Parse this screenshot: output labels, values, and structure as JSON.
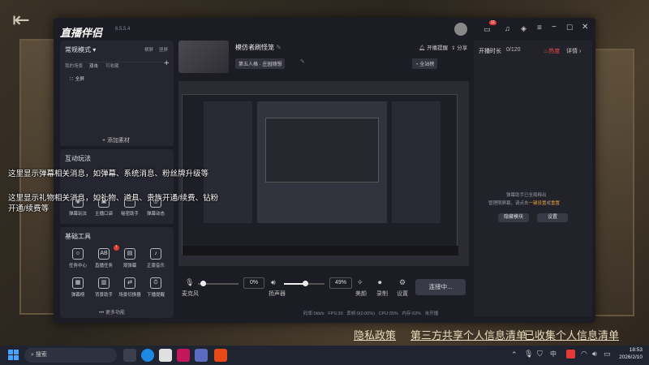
{
  "app": {
    "name": "直播伴侣",
    "version": "6.5.5.4"
  },
  "stream": {
    "title": "模仿者刷怪笼",
    "category": "第五人格 · 庄园随想",
    "fans_label": "全站榜"
  },
  "header": {
    "announce": "开播提醒",
    "share": "分享"
  },
  "left": {
    "mode": "常规模式",
    "mode_opts": [
      "横屏",
      "竖屏"
    ],
    "scene_tabs": [
      "我的场景",
      "双击",
      "可收藏"
    ],
    "source_item": "全屏",
    "add_source": "+ 添加素材",
    "interact_title": "互动玩法",
    "interact_items": [
      "弹幕玩法",
      "主播口袋",
      "秘密助手",
      "弹幕动态"
    ],
    "basic_title": "基础工具",
    "tools_row1": [
      "任务中心",
      "直播任务",
      "观弹幕",
      "正版音乐"
    ],
    "tools_row2": [
      "弹幕榜",
      "背景助手",
      "场景切换器",
      "下播提醒"
    ],
    "more": "••• 更多功能"
  },
  "overlay": {
    "line1": "这里显示弹幕相关消息，如弹幕、系统消息、粉丝牌升级等",
    "line2a": "这里显示礼物相关消息，如礼物、道具、贵族开通/续费、钻粉",
    "line2b": "开通/续费等"
  },
  "controls": {
    "mic": "麦克风",
    "mic_value": "0%",
    "speaker": "扬声器",
    "speaker_value": "49%",
    "beauty": "美颜",
    "record": "录制",
    "settings": "设置",
    "connect": "连接中..."
  },
  "status": {
    "bitrate": "码率:0kb/s",
    "fps": "FPS:30",
    "drop": "丢帧:0(0.00%)",
    "cpu": "CPU:35%",
    "mem": "内存:63%",
    "live": "未开播"
  },
  "right": {
    "live_time": "开播时长",
    "count": "0/120",
    "hot": "热度",
    "details": "详情 ›",
    "notice1": "弹幕助手已全局释出",
    "notice2": "管理限屏幕，请点击",
    "notice_link1": "一键设置",
    "notice_mid": "或",
    "notice_link2": "重置",
    "hide_btn": "隐藏模块",
    "settings_btn": "设置"
  },
  "bottom_links": [
    "隐私政策",
    "第三方共享个人信息清单",
    "已收集个人信息清单"
  ],
  "taskbar": {
    "search": "搜索",
    "ime": "中",
    "time": "18:53",
    "date": "2026/2/10"
  },
  "titlebar": {
    "badge": "11"
  }
}
